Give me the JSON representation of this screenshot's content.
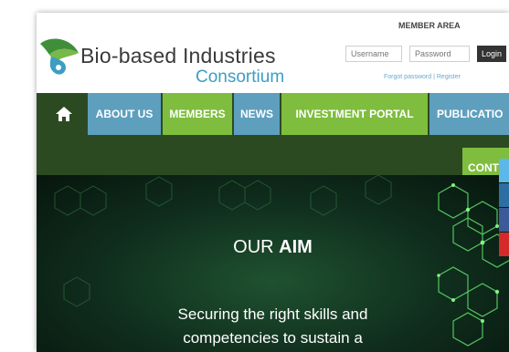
{
  "header": {
    "logo_line1": "Bio-based Industries",
    "logo_line2": "Consortium"
  },
  "member_area": {
    "title": "MEMBER AREA",
    "username_placeholder": "Username",
    "password_placeholder": "Password",
    "login_label": "Login",
    "forgot_link": "Forgot password",
    "separator": "|",
    "register_link": "Register"
  },
  "nav": {
    "home_icon": "home-icon",
    "items": [
      {
        "label": "ABOUT US",
        "color": "#5e9fbe"
      },
      {
        "label": "MEMBERS",
        "color": "#7fbd3e"
      },
      {
        "label": "NEWS",
        "color": "#5e9fbe"
      },
      {
        "label": "INVESTMENT PORTAL",
        "color": "#7fbd3e"
      },
      {
        "label": "PUBLICATIO",
        "color": "#5e9fbe"
      }
    ],
    "contact_label": "CONT"
  },
  "hero": {
    "aim_prefix": "OUR",
    "aim_bold": "AIM",
    "tagline_line1": "Securing the right skills and",
    "tagline_line2": "competencies to sustain a"
  },
  "social": [
    "twitter-icon",
    "linkedin-icon",
    "facebook-icon",
    "youtube-icon"
  ],
  "colors": {
    "nav_dark": "#2c4a22",
    "nav_blue": "#5e9fbe",
    "nav_green": "#7fbd3e",
    "logo_blue": "#3d9ec2"
  }
}
